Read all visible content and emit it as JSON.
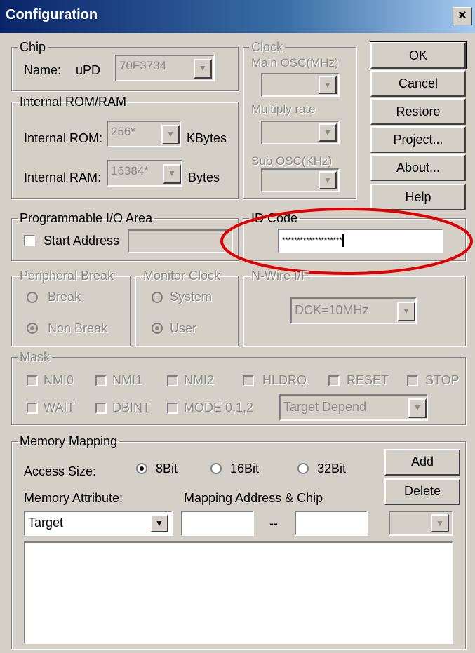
{
  "window": {
    "title": "Configuration",
    "close_glyph": "×"
  },
  "buttons": {
    "ok": "OK",
    "cancel": "Cancel",
    "restore": "Restore",
    "project": "Project...",
    "about": "About...",
    "help": "Help",
    "add": "Add",
    "delete": "Delete"
  },
  "chip": {
    "legend": "Chip",
    "name_label": "Name:",
    "prefix": "uPD",
    "value": "70F3734"
  },
  "rom_ram": {
    "legend": "Internal ROM/RAM",
    "rom_label": "Internal ROM:",
    "rom_value": "256*",
    "rom_unit": "KBytes",
    "ram_label": "Internal RAM:",
    "ram_value": "16384*",
    "ram_unit": "Bytes"
  },
  "clock": {
    "legend": "Clock",
    "main_osc_label": "Main OSC(MHz)",
    "multiply_label": "Multiply rate",
    "sub_osc_label": "Sub OSC(KHz)"
  },
  "prog_io": {
    "legend": "Programmable I/O Area",
    "start_address_label": "Start Address",
    "start_address_value": ""
  },
  "id_code": {
    "legend": "ID Code",
    "value": "********************"
  },
  "peripheral_break": {
    "legend": "Peripheral Break",
    "options": [
      "Break",
      "Non Break"
    ],
    "selected": "Non Break"
  },
  "monitor_clock": {
    "legend": "Monitor Clock",
    "options": [
      "System",
      "User"
    ],
    "selected": "User"
  },
  "nwire": {
    "legend": "N-Wire I/F",
    "value": "DCK=10MHz"
  },
  "mask": {
    "legend": "Mask",
    "row1": [
      "NMI0",
      "NMI1",
      "NMI2",
      "HLDRQ",
      "RESET",
      "STOP"
    ],
    "row2": [
      "WAIT",
      "DBINT",
      "MODE 0,1,2"
    ],
    "target_value": "Target Depend"
  },
  "memory_mapping": {
    "legend": "Memory Mapping",
    "access_size_label": "Access Size:",
    "access_options": [
      "8Bit",
      "16Bit",
      "32Bit"
    ],
    "access_selected": "8Bit",
    "attribute_label": "Memory Attribute:",
    "mapping_label": "Mapping Address & Chip",
    "attribute_value": "Target",
    "range_sep": "--",
    "address_from": "",
    "address_to": "",
    "chip_value": ""
  },
  "icons": {
    "dropdown": "▼",
    "highlight": "red-ellipse"
  },
  "colors": {
    "title_start": "#0a246a",
    "title_end": "#a6caf0",
    "dialog_bg": "#d4d0c8",
    "highlight": "#e00000"
  }
}
